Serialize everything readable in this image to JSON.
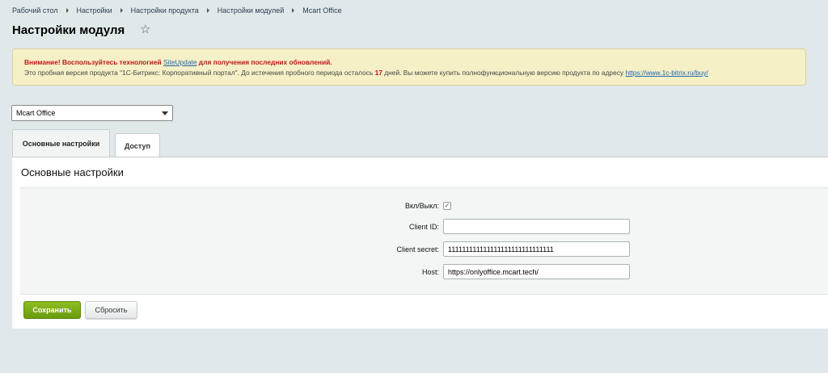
{
  "breadcrumb": [
    "Рабочий стол",
    "Настройки",
    "Настройки продукта",
    "Настройки модулей",
    "Mcart Office"
  ],
  "page_title": "Настройки модуля",
  "notice": {
    "warn_prefix": "Внимание! Воспользуйтесь технологией ",
    "warn_link": "SiteUpdate",
    "warn_suffix": " для получения последних обновлений.",
    "trial_prefix": "Это пробная версия продукта \"1С-Битрикс: Корпоративный портал\". До истечения пробного периода осталось ",
    "trial_days": "17",
    "trial_middle": " дней. Вы можете купить полнофункциональную версию продукта по адресу ",
    "trial_link": "https://www.1c-bitrix.ru/buy/"
  },
  "module_select": {
    "selected": "Mcart Office"
  },
  "tabs": [
    {
      "label": "Основные настройки",
      "active": true
    },
    {
      "label": "Доступ",
      "active": false
    }
  ],
  "panel_title": "Основные настройки",
  "form": {
    "enabled_label": "Вкл/Выкл:",
    "enabled_checked": true,
    "client_id_label": "Client ID:",
    "client_id_value": "",
    "client_secret_label": "Client secret:",
    "client_secret_value": "111111111111111111111111111111",
    "host_label": "Host:",
    "host_value": "https://onlyoffice.mcart.tech/"
  },
  "buttons": {
    "save": "Сохранить",
    "reset": "Сбросить"
  },
  "icons": {
    "favorite": "star-icon",
    "select_arrow": "chevron-down-icon",
    "check": "check-icon"
  },
  "colors": {
    "accent_green": "#7aab17",
    "warning_red": "#c0161a",
    "link_blue": "#2067b0",
    "notice_bg": "#f5f0c6"
  }
}
